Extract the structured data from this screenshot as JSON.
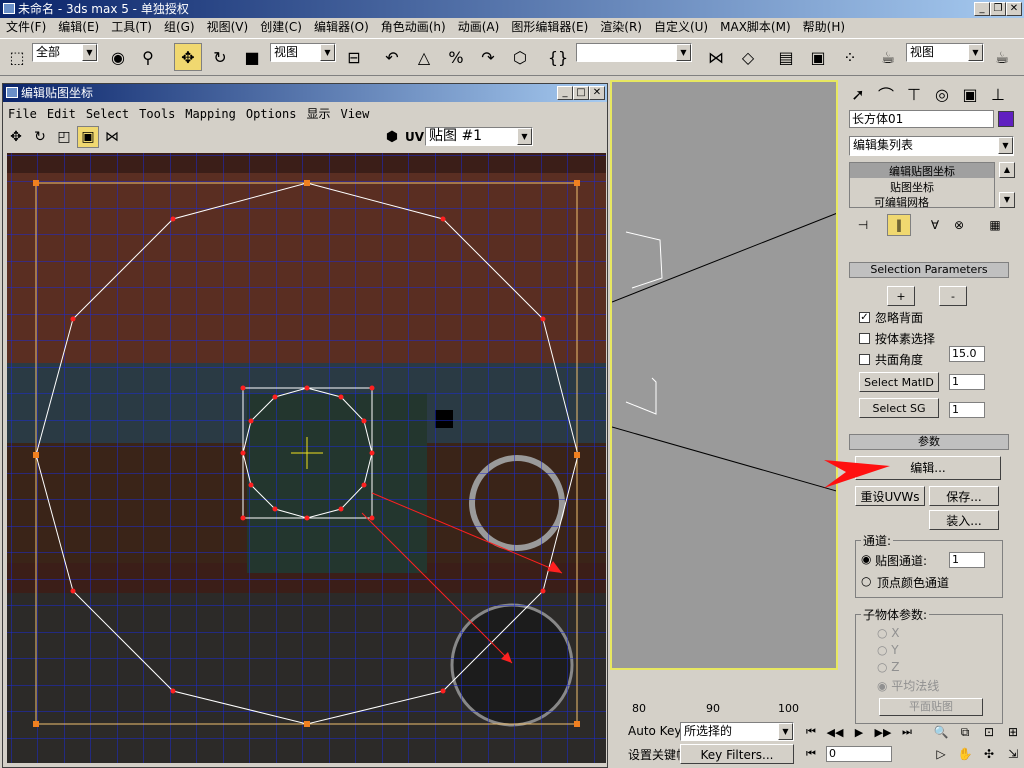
{
  "window": {
    "title": "未命名 - 3ds max 5 - 单独授权"
  },
  "menu": [
    "文件(F)",
    "编辑(E)",
    "工具(T)",
    "组(G)",
    "视图(V)",
    "创建(C)",
    "编辑器(O)",
    "角色动画(h)",
    "动画(A)",
    "图形编辑器(E)",
    "渲染(R)",
    "自定义(U)",
    "MAX脚本(M)",
    "帮助(H)"
  ],
  "toolbar": {
    "selection_filter": "全部",
    "ref_coord": "视图",
    "named_sel": "",
    "view_right": "视图"
  },
  "uv_editor": {
    "title": "编辑贴图坐标",
    "menu": [
      "File",
      "Edit",
      "Select",
      "Tools",
      "Mapping",
      "Options",
      "显示",
      "View"
    ],
    "uv_label": "UV",
    "map_select": "贴图 #1"
  },
  "panel": {
    "object_name": "长方体01",
    "modifier_list": "编辑集列表",
    "stack": [
      "编辑贴图坐标",
      "贴图坐标",
      "可编辑网格"
    ],
    "selection_params": {
      "header": "Selection Parameters",
      "plus": "+",
      "minus": "-",
      "ignore_backface": "忽略背面",
      "select_by_element": "按体素选择",
      "planar_angle": "共面角度",
      "planar_value": "15.0",
      "select_matid": "Select MatID",
      "matid_value": "1",
      "select_sg": "Select SG",
      "sg_value": "1"
    },
    "params": {
      "header": "参数",
      "edit": "编辑...",
      "reset": "重设UVWs",
      "save": "保存...",
      "load": "装入...",
      "channel_group": "通道:",
      "map_channel": "贴图通道:",
      "map_channel_value": "1",
      "vertex_color": "顶点颜色通道",
      "subobject_group": "子物体参数:",
      "x": "X",
      "y": "Y",
      "z": "Z",
      "average_normal": "平均法线",
      "planar_map": "平面贴图"
    }
  },
  "timeline": {
    "ticks": [
      "80",
      "90",
      "100"
    ]
  },
  "bottom": {
    "auto_key": "Auto Key",
    "selected": "所选择的",
    "set_key": "设置关键帧",
    "key_filters": "Key Filters...",
    "frame": "0"
  }
}
